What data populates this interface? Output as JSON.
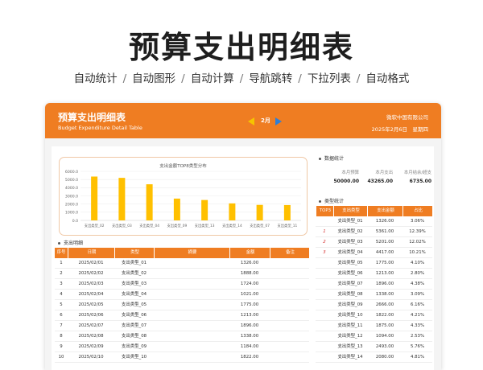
{
  "hero": {
    "title": "预算支出明细表",
    "features": [
      "自动统计",
      "自动图形",
      "自动计算",
      "导航跳转",
      "下拉列表",
      "自动格式"
    ],
    "separator": "/"
  },
  "header": {
    "title": "预算支出明细表",
    "subtitle": "Budget Expenditure Detail Table",
    "month": "2月",
    "company": "微软中国有限公司",
    "date": "2025年2月6日",
    "weekday": "星期四"
  },
  "chart_data": {
    "type": "bar",
    "title": "支出金额TOP8类型分布",
    "categories": [
      "支出类型_02",
      "支出类型_03",
      "支出类型_04",
      "支出类型_09",
      "支出类型_13",
      "支出类型_14",
      "支出类型_07",
      "支出类型_11"
    ],
    "values": [
      5361,
      5201,
      4417,
      2666,
      2493,
      2080,
      1896,
      1875
    ],
    "ylim": [
      0,
      6000
    ],
    "yticks": [
      "0.0",
      "1000.0",
      "2000.0",
      "3000.0",
      "4000.0",
      "5000.0",
      "6000.0"
    ],
    "xlabel": "",
    "ylabel": "",
    "bar_color": "#ffc000",
    "grid": true
  },
  "detail": {
    "section_title": "支出明细",
    "columns": [
      "序号",
      "日期",
      "类型",
      "摘要",
      "金额",
      "备注"
    ],
    "rows": [
      [
        "1",
        "2025/02/01",
        "支出类型_01",
        "",
        "1326.00",
        ""
      ],
      [
        "2",
        "2025/02/02",
        "支出类型_02",
        "",
        "1888.00",
        ""
      ],
      [
        "3",
        "2025/02/03",
        "支出类型_03",
        "",
        "1724.00",
        ""
      ],
      [
        "4",
        "2025/02/04",
        "支出类型_04",
        "",
        "1021.00",
        ""
      ],
      [
        "5",
        "2025/02/05",
        "支出类型_05",
        "",
        "1775.00",
        ""
      ],
      [
        "6",
        "2025/02/06",
        "支出类型_06",
        "",
        "1213.00",
        ""
      ],
      [
        "7",
        "2025/02/07",
        "支出类型_07",
        "",
        "1896.00",
        ""
      ],
      [
        "8",
        "2025/02/08",
        "支出类型_08",
        "",
        "1338.00",
        ""
      ],
      [
        "9",
        "2025/02/09",
        "支出类型_09",
        "",
        "1184.00",
        ""
      ],
      [
        "10",
        "2025/02/10",
        "支出类型_10",
        "",
        "1822.00",
        ""
      ]
    ]
  },
  "stats": {
    "section_title": "数据统计",
    "labels": [
      "本月预算",
      "本月支出",
      "本月结余/超支"
    ],
    "values": [
      "50000.00",
      "43265.00",
      "6735.00"
    ]
  },
  "type_stats": {
    "section_title": "类型统计",
    "columns": [
      "TOP3",
      "支出类型",
      "支出金额",
      "占比"
    ],
    "rows": [
      [
        "",
        "支出类型_01",
        "1326.00",
        "3.06%"
      ],
      [
        "1",
        "支出类型_02",
        "5361.00",
        "12.39%"
      ],
      [
        "2",
        "支出类型_03",
        "5201.00",
        "12.02%"
      ],
      [
        "3",
        "支出类型_04",
        "4417.00",
        "10.21%"
      ],
      [
        "",
        "支出类型_05",
        "1775.00",
        "4.10%"
      ],
      [
        "",
        "支出类型_06",
        "1213.00",
        "2.80%"
      ],
      [
        "",
        "支出类型_07",
        "1896.00",
        "4.38%"
      ],
      [
        "",
        "支出类型_08",
        "1338.00",
        "3.09%"
      ],
      [
        "",
        "支出类型_09",
        "2666.00",
        "6.16%"
      ],
      [
        "",
        "支出类型_10",
        "1822.00",
        "4.21%"
      ],
      [
        "",
        "支出类型_11",
        "1875.00",
        "4.33%"
      ],
      [
        "",
        "支出类型_12",
        "1094.00",
        "2.53%"
      ],
      [
        "",
        "支出类型_13",
        "2493.00",
        "5.76%"
      ],
      [
        "",
        "支出类型_14",
        "2080.00",
        "4.81%"
      ]
    ]
  },
  "colors": {
    "accent": "#ef7d22",
    "bar": "#ffc000",
    "nav_left": "#f6c400",
    "nav_right": "#2f7fd6",
    "rank": "#d52f2f"
  }
}
